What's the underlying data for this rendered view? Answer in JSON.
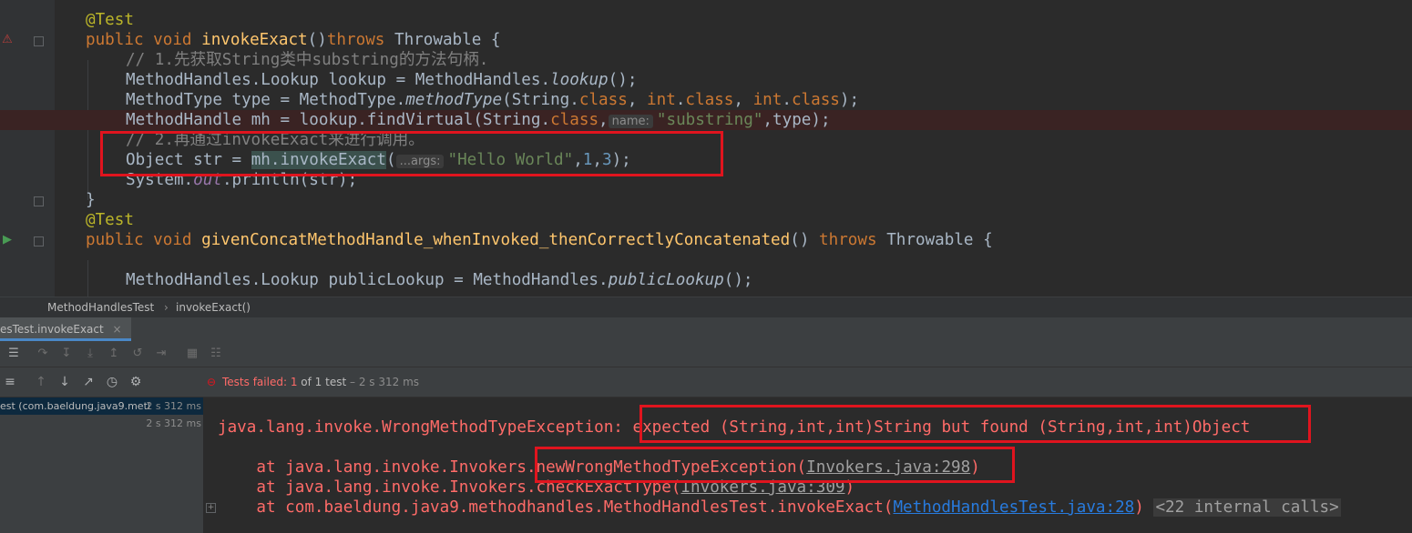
{
  "editor": {
    "lines": [
      [
        "@Test"
      ],
      [
        "public void ",
        "invokeExact",
        "()",
        "throws ",
        "Throwable {"
      ],
      [
        "// 1.先获取String类中substring的方法句柄."
      ],
      [
        "MethodHandles.Lookup lookup = MethodHandles.",
        "lookup",
        "();"
      ],
      [
        "MethodType type = MethodType.",
        "methodType",
        "(String.",
        "class",
        ", ",
        "int",
        ".",
        "class",
        ", ",
        "int",
        ".",
        "class",
        ");"
      ],
      [
        "MethodHandle mh = lookup.findVirtual(String.",
        "class",
        ",",
        "name:",
        "\"substring\"",
        ",type);"
      ],
      [
        "// 2.再通过invokeExact来进行调用。"
      ],
      [
        "Object str = ",
        "mh.invokeExact",
        "(",
        "...args:",
        "\"Hello World\"",
        ",",
        "1",
        ",",
        "3",
        ");"
      ],
      [
        "System.",
        "out",
        ".println(str);"
      ],
      [
        "}"
      ],
      [
        "@Test"
      ],
      [
        "public void ",
        "givenConcatMethodHandle_whenInvoked_thenCorrectlyConcatenated",
        "() ",
        "throws ",
        "Throwable {"
      ],
      [
        ""
      ],
      [
        "MethodHandles.Lookup publicLookup = MethodHandles.",
        "publicLookup",
        "();"
      ]
    ]
  },
  "breadcrumb": {
    "class": "MethodHandlesTest",
    "sep": "›",
    "method": "invokeExact()"
  },
  "run_tab": {
    "label": "esTest.invokeExact",
    "close": "×"
  },
  "status": {
    "icon": "⊖",
    "failed_label": "Tests failed:",
    "failed_count": "1",
    "of_text": "of 1 test",
    "dash": "–",
    "duration": "2 s 312 ms"
  },
  "tree": [
    {
      "label": "est (com.baeldung.java9.metl",
      "duration": "2 s 312 ms"
    },
    {
      "label": "",
      "duration": "2 s 312 ms"
    }
  ],
  "console": {
    "exception": "java.lang.invoke.WrongMethodTypeException:",
    "message": "expected (String,int,int)String but found (String,int,int)Object",
    "trace1_prefix": "    at java.lang.invoke.Invokers",
    "trace1_method": ".newWrongMethodTypeException(",
    "trace1_link": "Invokers.java:298",
    "trace1_suffix": ")",
    "trace2_prefix": "    at java.lang.invoke.Invokers.checkExactType(",
    "trace2_link": "Invokers.java:309",
    "trace2_suffix": ")",
    "trace3_prefix": "    at com.baeldung.java9.methodhandles.MethodHandlesTest.invokeExact(",
    "trace3_link": "MethodHandlesTest.java:28",
    "trace3_suffix": ")",
    "trace3_internal": "<22 internal calls>"
  },
  "colors": {
    "accent_red": "#e0141e",
    "error_text": "#ff6b68",
    "link": "#287bde"
  }
}
